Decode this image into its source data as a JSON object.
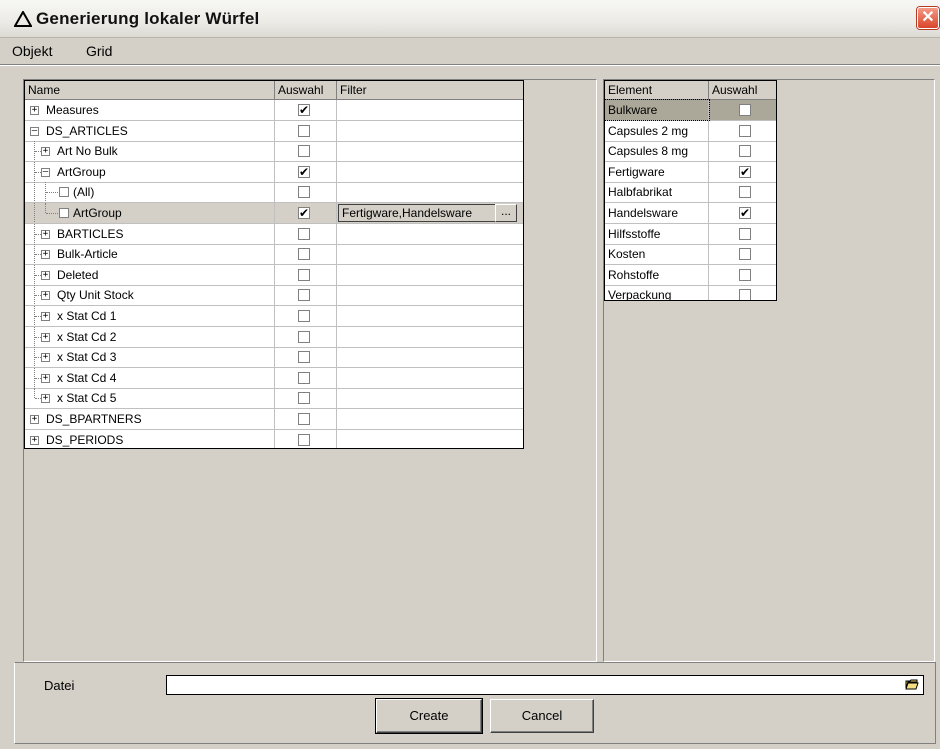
{
  "window": {
    "title": "Generierung lokaler Würfel",
    "close_glyph": "✕"
  },
  "menu": {
    "items": [
      "Objekt",
      "Grid"
    ]
  },
  "left_grid": {
    "columns": [
      "Name",
      "Auswahl",
      "Filter"
    ],
    "rows": [
      {
        "label": "Measures",
        "level": 0,
        "expander": "+",
        "checked": true
      },
      {
        "label": "DS_ARTICLES",
        "level": 0,
        "expander": "−",
        "checked": false
      },
      {
        "label": "Art No Bulk",
        "level": 1,
        "expander": "+",
        "checked": false
      },
      {
        "label": "ArtGroup",
        "level": 1,
        "expander": "−",
        "checked": true
      },
      {
        "label": "(All)",
        "level": 2,
        "expander": "",
        "checked": false,
        "inline_checkbox": true
      },
      {
        "label": "ArtGroup",
        "level": 2,
        "expander": "",
        "checked": true,
        "selected": true,
        "filter": "Fertigware,Handelsware",
        "filter_button": "..."
      },
      {
        "label": "BARTICLES",
        "level": 1,
        "expander": "+",
        "checked": false
      },
      {
        "label": "Bulk-Article",
        "level": 1,
        "expander": "+",
        "checked": false
      },
      {
        "label": "Deleted",
        "level": 1,
        "expander": "+",
        "checked": false
      },
      {
        "label": "Qty Unit Stock",
        "level": 1,
        "expander": "+",
        "checked": false
      },
      {
        "label": "x Stat Cd 1",
        "level": 1,
        "expander": "+",
        "checked": false
      },
      {
        "label": "x Stat Cd 2",
        "level": 1,
        "expander": "+",
        "checked": false
      },
      {
        "label": "x Stat Cd 3",
        "level": 1,
        "expander": "+",
        "checked": false
      },
      {
        "label": "x Stat Cd 4",
        "level": 1,
        "expander": "+",
        "checked": false
      },
      {
        "label": "x Stat Cd 5",
        "level": 1,
        "expander": "+",
        "checked": false
      },
      {
        "label": "DS_BPARTNERS",
        "level": 0,
        "expander": "+",
        "checked": false
      },
      {
        "label": "DS_PERIODS",
        "level": 0,
        "expander": "+",
        "checked": false
      }
    ]
  },
  "right_grid": {
    "columns": [
      "Element",
      "Auswahl"
    ],
    "rows": [
      {
        "label": "Bulkware",
        "checked": false,
        "selected": true
      },
      {
        "label": "Capsules 2 mg",
        "checked": false
      },
      {
        "label": "Capsules 8 mg",
        "checked": false
      },
      {
        "label": "Fertigware",
        "checked": true
      },
      {
        "label": "Halbfabrikat",
        "checked": false
      },
      {
        "label": "Handelsware",
        "checked": true
      },
      {
        "label": "Hilfsstoffe",
        "checked": false
      },
      {
        "label": "Kosten",
        "checked": false
      },
      {
        "label": "Rohstoffe",
        "checked": false
      },
      {
        "label": "Verpackung",
        "checked": false
      }
    ]
  },
  "footer": {
    "file_label": "Datei",
    "file_value": "",
    "create_label": "Create",
    "cancel_label": "Cancel"
  },
  "colors": {
    "selected_row": "#d4d0c8",
    "selected_right_row": "#aca899",
    "close_button": "#d9442a"
  }
}
